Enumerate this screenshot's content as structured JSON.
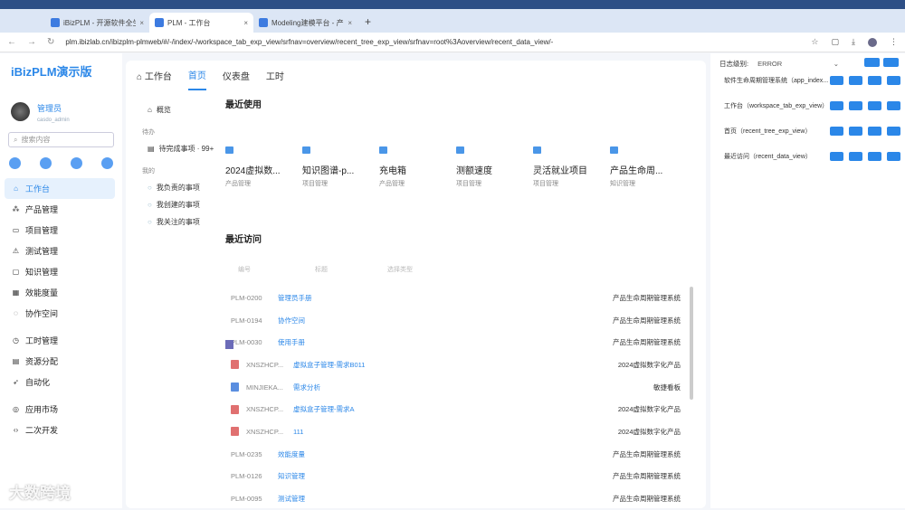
{
  "browser": {
    "tabs": [
      {
        "title": "iBizPLM - 开源软件全生命周期管理",
        "active": false
      },
      {
        "title": "PLM - 工作台",
        "active": true
      },
      {
        "title": "Modeling建模平台 - 产品生命周期",
        "active": false
      }
    ],
    "new_tab": "+",
    "url": "plm.ibizlab.cn/ibizplm-plmweb/#/-/index/-/workspace_tab_exp_view/srfnav=overview/recent_tree_exp_view/srfnav=root%3Aoverview/recent_data_view/-",
    "profile_initial": "S"
  },
  "sidebar": {
    "logo": "iBizPLM演示版",
    "user_name": "管理员",
    "user_id": "casdo_admin",
    "search_placeholder": "搜索内容",
    "quick_icons": [
      "bell-icon",
      "gear-icon",
      "help-icon",
      "add-icon"
    ],
    "groups": [
      [
        {
          "label": "工作台",
          "icon": "⌂",
          "active": true
        },
        {
          "label": "产品管理",
          "icon": "⁂"
        },
        {
          "label": "项目管理",
          "icon": "▭"
        },
        {
          "label": "测试管理",
          "icon": "⚠"
        },
        {
          "label": "知识管理",
          "icon": "▢"
        },
        {
          "label": "效能度量",
          "icon": "▦"
        },
        {
          "label": "协作空间",
          "icon": "◌"
        }
      ],
      [
        {
          "label": "工时管理",
          "icon": "◷"
        },
        {
          "label": "资源分配",
          "icon": "▤"
        },
        {
          "label": "自动化",
          "icon": "➶"
        }
      ],
      [
        {
          "label": "应用市场",
          "icon": "◎"
        },
        {
          "label": "二次开发",
          "icon": "‹›"
        }
      ]
    ]
  },
  "main": {
    "tabs": [
      {
        "label": "工作台",
        "icon": "home-icon"
      },
      {
        "label": "首页",
        "active": true
      },
      {
        "label": "仪表盘"
      },
      {
        "label": "工时"
      }
    ],
    "left_nav": {
      "overview": "概览",
      "todo_header": "待办",
      "todo_item": "待完成事项 · 99+",
      "mine_header": "我的",
      "mine_items": [
        "我负责的事项",
        "我创建的事项",
        "我关注的事项"
      ]
    },
    "recent_used_title": "最近使用",
    "recent_used": [
      {
        "name": "2024虚拟数...",
        "category": "产品管理"
      },
      {
        "name": "知识图谱-p...",
        "category": "项目管理"
      },
      {
        "name": "充电箱",
        "category": "产品管理"
      },
      {
        "name": "测额速度",
        "category": "项目管理"
      },
      {
        "name": "灵活就业项目",
        "category": "项目管理"
      },
      {
        "name": "产品生命周...",
        "category": "知识管理"
      }
    ],
    "recent_visit_title": "最近访问",
    "table_headers": [
      "编号",
      "标题",
      "选择类型"
    ],
    "rows": [
      {
        "type": "page",
        "id": "PLM-0200",
        "title": "管理员手册",
        "parent": "产品生命周期管理系统"
      },
      {
        "type": "page",
        "id": "PLM-0194",
        "title": "协作空间",
        "parent": "产品生命周期管理系统"
      },
      {
        "type": "page",
        "id": "PLM-0030",
        "title": "使用手册",
        "parent": "产品生命周期管理系统"
      },
      {
        "type": "req",
        "id": "XNSZHCP...",
        "title": "虚拟盒子管理-需求B011",
        "parent": "2024虚拟数字化产品"
      },
      {
        "type": "task",
        "id": "MINJIEKA...",
        "title": "需求分析",
        "parent": "敏捷看板"
      },
      {
        "type": "req",
        "id": "XNSZHCP...",
        "title": "虚拟盒子管理-需求A",
        "parent": "2024虚拟数字化产品"
      },
      {
        "type": "req",
        "id": "XNSZHCP...",
        "title": "111",
        "parent": "2024虚拟数字化产品"
      },
      {
        "type": "page",
        "id": "PLM-0235",
        "title": "效能度量",
        "parent": "产品生命周期管理系统"
      },
      {
        "type": "page",
        "id": "PLM-0126",
        "title": "知识管理",
        "parent": "产品生命周期管理系统"
      },
      {
        "type": "page",
        "id": "PLM-0095",
        "title": "测试管理",
        "parent": "产品生命周期管理系统"
      }
    ]
  },
  "debug": {
    "log_label": "日志级别:",
    "log_level": "ERROR",
    "views": [
      "软件生命周期管理系统（app_index...",
      "工作台（workspace_tab_exp_view）",
      "首页（recent_tree_exp_view）",
      "最近访问（recent_data_view）"
    ]
  },
  "watermark": "大数跨境"
}
